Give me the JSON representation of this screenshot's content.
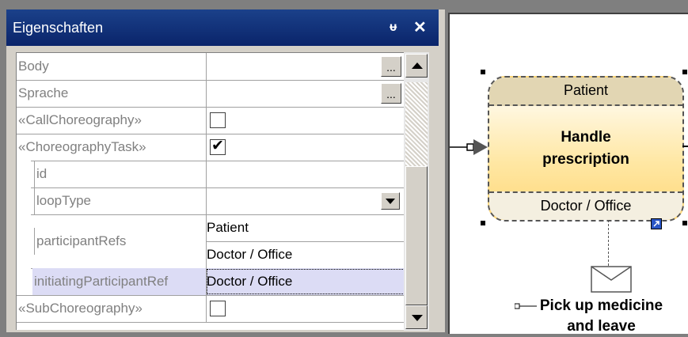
{
  "panel": {
    "title": "Eigenschaften",
    "pin_glyph": "ᵾ",
    "close_glyph": "✕"
  },
  "properties": {
    "rows": [
      {
        "label": "Body",
        "value": ""
      },
      {
        "label": "Sprache",
        "value": ""
      },
      {
        "label": "«CallChoreography»",
        "checked": false
      },
      {
        "label": "«ChoreographyTask»",
        "checked": true
      },
      {
        "label": "id",
        "value": ""
      },
      {
        "label": "loopType",
        "value": ""
      },
      {
        "label": "participantRefs",
        "values": [
          "Patient",
          "Doctor / Office"
        ]
      },
      {
        "label": "initiatingParticipantRef",
        "value": "Doctor / Office"
      },
      {
        "label": "«SubChoreography»",
        "checked": false
      }
    ],
    "ellipsis": "..."
  },
  "diagram": {
    "task": {
      "top_participant": "Patient",
      "name": "Handle\nprescription",
      "bottom_participant": "Doctor / Office"
    },
    "message_label": "Pick up medicine\nand leave"
  },
  "colors": {
    "title_bar": "#0a246a",
    "task_fill": "#ffd778",
    "selection": "#dcdcf5"
  },
  "icons": [
    "pin-icon",
    "close-icon",
    "ellipsis-button",
    "checkbox",
    "dropdown-arrow",
    "scroll-up-arrow",
    "scroll-down-arrow",
    "envelope-icon",
    "link-icon"
  ]
}
